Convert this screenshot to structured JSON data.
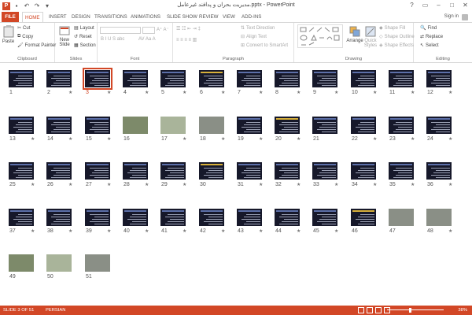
{
  "window": {
    "title": "مدیریت بحران و پدافند غیرعامل.pptx - PowerPoint",
    "app_icon": "P",
    "controls": [
      "?",
      "▭",
      "–",
      "□",
      "✕"
    ]
  },
  "tabs": [
    {
      "label": "FILE"
    },
    {
      "label": "HOME"
    },
    {
      "label": "INSERT"
    },
    {
      "label": "DESIGN"
    },
    {
      "label": "TRANSITIONS"
    },
    {
      "label": "ANIMATIONS"
    },
    {
      "label": "SLIDE SHOW"
    },
    {
      "label": "REVIEW"
    },
    {
      "label": "VIEW"
    },
    {
      "label": "ADD-INS"
    }
  ],
  "signin": "Sign in",
  "ribbon": {
    "clipboard": {
      "label": "Clipboard",
      "paste": "Paste",
      "cut": "Cut",
      "copy": "Copy",
      "format_painter": "Format Painter"
    },
    "slides": {
      "label": "Slides",
      "new_slide": "New",
      "new_slide2": "Slide",
      "layout": "Layout",
      "reset": "Reset",
      "section": "Section"
    },
    "font": {
      "label": "Font"
    },
    "paragraph": {
      "label": "Paragraph",
      "text_direction": "Text Direction",
      "align_text": "Align Text",
      "smartart": "Convert to SmartArt"
    },
    "drawing": {
      "label": "Drawing",
      "arrange": "Arrange",
      "quick_styles": "Quick",
      "quick_styles2": "Styles",
      "shape_fill": "Shape Fill",
      "shape_outline": "Shape Outline",
      "shape_effects": "Shape Effects"
    },
    "editing": {
      "label": "Editing",
      "find": "Find",
      "replace": "Replace",
      "select": "Select"
    }
  },
  "slides": [
    {
      "n": "1",
      "star": false,
      "kind": "dark"
    },
    {
      "n": "2",
      "star": true,
      "kind": "dark"
    },
    {
      "n": "3",
      "star": true,
      "kind": "dark",
      "selected": true
    },
    {
      "n": "4",
      "star": true,
      "kind": "dark"
    },
    {
      "n": "5",
      "star": true,
      "kind": "dark"
    },
    {
      "n": "6",
      "star": true,
      "kind": "color"
    },
    {
      "n": "7",
      "star": true,
      "kind": "dark"
    },
    {
      "n": "8",
      "star": true,
      "kind": "dark"
    },
    {
      "n": "9",
      "star": true,
      "kind": "dark"
    },
    {
      "n": "10",
      "star": true,
      "kind": "dark"
    },
    {
      "n": "11",
      "star": true,
      "kind": "dark"
    },
    {
      "n": "12",
      "star": true,
      "kind": "dark"
    },
    {
      "n": "13",
      "star": true,
      "kind": "dark"
    },
    {
      "n": "14",
      "star": true,
      "kind": "dark"
    },
    {
      "n": "15",
      "star": true,
      "kind": "dark"
    },
    {
      "n": "16",
      "star": false,
      "kind": "photo"
    },
    {
      "n": "17",
      "star": true,
      "kind": "photo2"
    },
    {
      "n": "18",
      "star": true,
      "kind": "photo3"
    },
    {
      "n": "19",
      "star": true,
      "kind": "dark"
    },
    {
      "n": "20",
      "star": true,
      "kind": "color"
    },
    {
      "n": "21",
      "star": false,
      "kind": "dark"
    },
    {
      "n": "22",
      "star": true,
      "kind": "dark"
    },
    {
      "n": "23",
      "star": true,
      "kind": "dark"
    },
    {
      "n": "24",
      "star": true,
      "kind": "dark"
    },
    {
      "n": "25",
      "star": true,
      "kind": "dark"
    },
    {
      "n": "26",
      "star": true,
      "kind": "dark"
    },
    {
      "n": "27",
      "star": true,
      "kind": "dark"
    },
    {
      "n": "28",
      "star": true,
      "kind": "dark"
    },
    {
      "n": "29",
      "star": true,
      "kind": "dark"
    },
    {
      "n": "30",
      "star": false,
      "kind": "color"
    },
    {
      "n": "31",
      "star": true,
      "kind": "dark"
    },
    {
      "n": "32",
      "star": true,
      "kind": "dark"
    },
    {
      "n": "33",
      "star": true,
      "kind": "dark"
    },
    {
      "n": "34",
      "star": true,
      "kind": "dark"
    },
    {
      "n": "35",
      "star": true,
      "kind": "dark"
    },
    {
      "n": "36",
      "star": true,
      "kind": "dark"
    },
    {
      "n": "37",
      "star": true,
      "kind": "dark"
    },
    {
      "n": "38",
      "star": true,
      "kind": "dark"
    },
    {
      "n": "39",
      "star": true,
      "kind": "dark"
    },
    {
      "n": "40",
      "star": true,
      "kind": "dark"
    },
    {
      "n": "41",
      "star": true,
      "kind": "dark"
    },
    {
      "n": "42",
      "star": true,
      "kind": "dark"
    },
    {
      "n": "43",
      "star": true,
      "kind": "dark"
    },
    {
      "n": "44",
      "star": true,
      "kind": "dark"
    },
    {
      "n": "45",
      "star": true,
      "kind": "dark"
    },
    {
      "n": "46",
      "star": false,
      "kind": "color"
    },
    {
      "n": "47",
      "star": false,
      "kind": "photo3"
    },
    {
      "n": "48",
      "star": true,
      "kind": "photo3"
    },
    {
      "n": "49",
      "star": false,
      "kind": "photo"
    },
    {
      "n": "50",
      "star": false,
      "kind": "photo2"
    },
    {
      "n": "51",
      "star": false,
      "kind": "photo3"
    }
  ],
  "status": {
    "slide_info": "SLIDE 3 OF 51",
    "language": "PERSIAN",
    "zoom": "38%"
  },
  "colors": {
    "accent": "#d24726"
  }
}
